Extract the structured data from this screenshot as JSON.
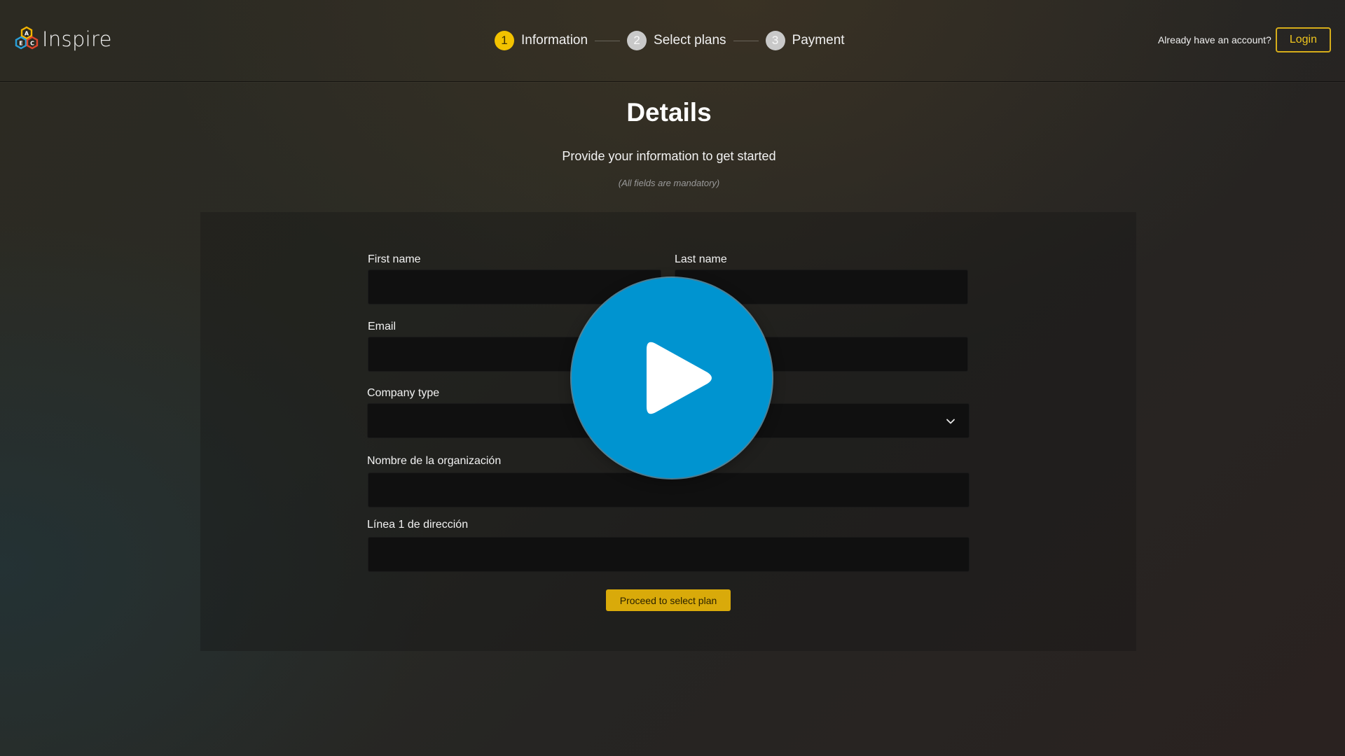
{
  "brand": {
    "name": "Inspire",
    "logo_letters": [
      "A",
      "E",
      "C"
    ],
    "logo_colors": [
      "#f4b400",
      "#2a9fd8",
      "#e0452b"
    ]
  },
  "stepper": {
    "steps": [
      {
        "number": "1",
        "label": "Information",
        "active": true
      },
      {
        "number": "2",
        "label": "Select plans",
        "active": false
      },
      {
        "number": "3",
        "label": "Payment",
        "active": false
      }
    ]
  },
  "account": {
    "prompt": "Already have an account?",
    "login_label": "Login"
  },
  "heading": {
    "title": "Details",
    "subtitle": "Provide your information to get started",
    "note": "(All fields are mandatory)"
  },
  "form": {
    "first_name": {
      "label": "First name",
      "value": ""
    },
    "last_name": {
      "label": "Last name",
      "value": ""
    },
    "email": {
      "label": "Email",
      "value": ""
    },
    "company_type": {
      "label": "Company type",
      "value": ""
    },
    "organization": {
      "label": "Nombre de la organización",
      "value": ""
    },
    "address_line_1": {
      "label": "Línea 1 de dirección",
      "value": ""
    },
    "submit_label": "Proceed to select plan"
  },
  "overlay": {
    "icon": "play-icon",
    "color": "#0094d0"
  },
  "colors": {
    "accent": "#d9aa0a",
    "step_active": "#f2c200",
    "step_inactive": "#c9c9c9"
  }
}
